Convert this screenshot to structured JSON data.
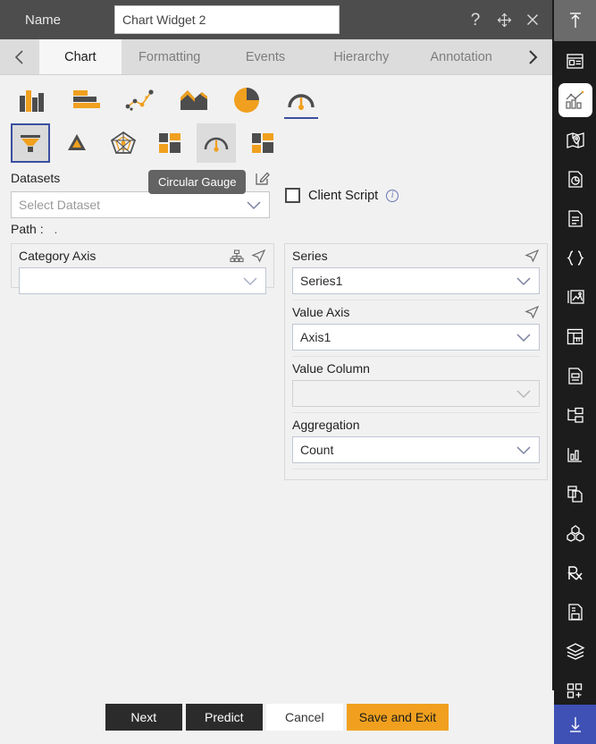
{
  "header": {
    "name_label": "Name",
    "name_value": "Chart Widget 2",
    "help_icon": "?",
    "move_icon": "move-icon",
    "close_icon": "close-icon"
  },
  "tabs": {
    "prev_arrow": "‹",
    "next_arrow": "›",
    "items": [
      {
        "label": "Chart",
        "active": true
      },
      {
        "label": "Formatting",
        "active": false
      },
      {
        "label": "Events",
        "active": false
      },
      {
        "label": "Hierarchy",
        "active": false
      },
      {
        "label": "Annotation",
        "active": false
      }
    ]
  },
  "chart_types": {
    "row1": [
      {
        "name": "column-chart-icon",
        "state": "normal"
      },
      {
        "name": "bar-chart-icon",
        "state": "normal"
      },
      {
        "name": "scatter-line-chart-icon",
        "state": "normal"
      },
      {
        "name": "area-chart-icon",
        "state": "normal"
      },
      {
        "name": "pie-chart-icon",
        "state": "normal"
      },
      {
        "name": "gauge-chart-icon",
        "state": "underlined"
      }
    ],
    "row2": [
      {
        "name": "funnel-chart-icon",
        "state": "selected"
      },
      {
        "name": "pyramid-chart-icon",
        "state": "normal"
      },
      {
        "name": "radar-chart-icon",
        "state": "normal"
      },
      {
        "name": "treemap-chart-icon",
        "state": "normal"
      },
      {
        "name": "circular-gauge-icon",
        "state": "hovered"
      },
      {
        "name": "tile-chart-icon",
        "state": "normal"
      }
    ],
    "tooltip": "Circular Gauge"
  },
  "datasets": {
    "label": "Datasets",
    "placeholder": "Select Dataset",
    "value": "",
    "path_label": "Path :",
    "path_value": ".",
    "home_icon": "home-icon",
    "add_icon": "add-icon",
    "edit_icon": "edit-icon"
  },
  "client_script": {
    "label": "Client Script",
    "checked": false,
    "info_icon": "info-icon"
  },
  "category_axis": {
    "label": "Category Axis",
    "value": "",
    "tree_icon": "hierarchy-icon",
    "send_icon": "navigate-icon"
  },
  "series_panel": {
    "series": {
      "label": "Series",
      "value": "Series1",
      "send_icon": "navigate-icon"
    },
    "value_axis": {
      "label": "Value Axis",
      "value": "Axis1",
      "send_icon": "navigate-icon"
    },
    "value_column": {
      "label": "Value Column",
      "value": ""
    },
    "aggregation": {
      "label": "Aggregation",
      "value": "Count"
    }
  },
  "footer": {
    "next": "Next",
    "predict": "Predict",
    "cancel": "Cancel",
    "save_and_exit": "Save and Exit"
  },
  "rail": {
    "top_icon": "collapse-up-icon",
    "items": [
      {
        "name": "widget-panel-icon",
        "active": false
      },
      {
        "name": "chart-icon",
        "active": true
      },
      {
        "name": "map-icon",
        "active": false
      },
      {
        "name": "report-pie-icon",
        "active": false
      },
      {
        "name": "document-icon",
        "active": false
      },
      {
        "name": "json-braces-icon",
        "active": false
      },
      {
        "name": "image-gallery-icon",
        "active": false
      },
      {
        "name": "table-layout-icon",
        "active": false
      },
      {
        "name": "form-document-icon",
        "active": false
      },
      {
        "name": "tree-structure-icon",
        "active": false
      },
      {
        "name": "analytics-icon",
        "active": false
      },
      {
        "name": "copy-page-icon",
        "active": false
      },
      {
        "name": "cube-group-icon",
        "active": false
      },
      {
        "name": "prescription-icon",
        "active": false
      },
      {
        "name": "saved-document-icon",
        "active": false
      },
      {
        "name": "layers-icon",
        "active": false
      },
      {
        "name": "add-widget-icon",
        "active": false
      }
    ],
    "bottom_icon": "download-icon"
  },
  "colors": {
    "accent_orange": "#f0a01e",
    "dark_gray": "#2b2b2b",
    "rail_dark": "#1c1c1c",
    "rail_active_blue": "#3f51b5",
    "select_blue": "#3b4fa0"
  }
}
